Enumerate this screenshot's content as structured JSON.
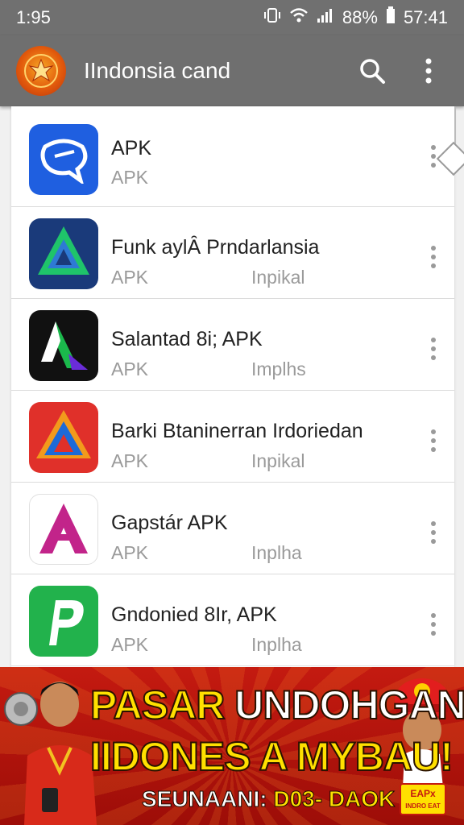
{
  "status": {
    "time": "1:95",
    "battery": "88%",
    "clock": "57:41"
  },
  "appbar": {
    "title": "IIndonsia cand",
    "search_icon": "search-icon",
    "menu_icon": "more-vert-icon"
  },
  "apps": [
    {
      "name": "APK",
      "sub": "APK",
      "sub2": "",
      "icon": "chat-bubble-icon",
      "color": "#1f5fe0"
    },
    {
      "name": "Funk aylȂ Prndarlansia",
      "sub": "APK",
      "sub2": "Inpikal",
      "icon": "triangle-icon",
      "color": "#1a3a7a"
    },
    {
      "name": "Salantad 8i; APK",
      "sub": "APK",
      "sub2": "Implhs",
      "icon": "a-logo-icon",
      "color": "#111111"
    },
    {
      "name": "Barki Btaninerran Irdoriedan",
      "sub": "APK",
      "sub2": "Inpikal",
      "icon": "a-triangle-icon",
      "color": "#e0302a"
    },
    {
      "name": "Gapstár APK",
      "sub": "APK",
      "sub2": "Inplha",
      "icon": "a-letter-icon",
      "color": "#ffffff"
    },
    {
      "name": "Gndonied 8Ir, APK",
      "sub": "APK",
      "sub2": "Inplha",
      "icon": "p-logo-icon",
      "color": "#22b24c"
    }
  ],
  "banner": {
    "line1_a": "PASAR",
    "line1_b": "UNDOHGAN",
    "line2": "IIDONES A MYBAU!",
    "line3_a": "SEUNAANI:",
    "line3_b": "D03- DAOK",
    "badge_top": "EAPx",
    "badge_bottom": "INDRO EAT"
  }
}
